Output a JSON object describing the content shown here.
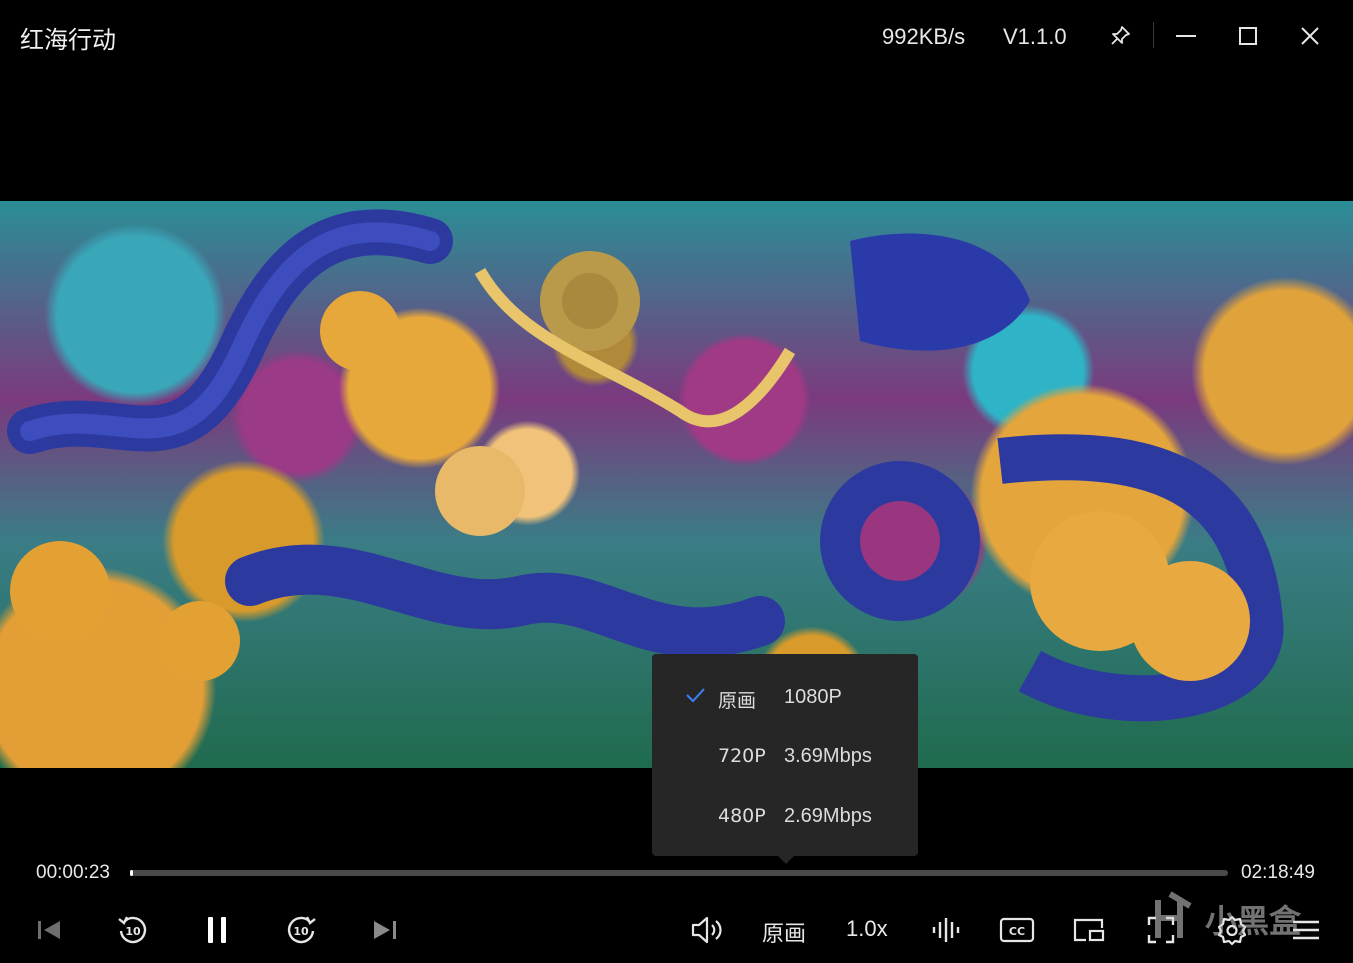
{
  "titlebar": {
    "title": "红海行动",
    "speed": "992KB/s",
    "version": "V1.1.0",
    "pin_icon": "pin-icon",
    "minimize_icon": "minimize-icon",
    "maximize_icon": "maximize-icon",
    "close_icon": "close-icon"
  },
  "quality_menu": {
    "items": [
      {
        "name": "原画",
        "rate": "1080P",
        "selected": true
      },
      {
        "name": "720P",
        "rate": "3.69Mbps",
        "selected": false
      },
      {
        "name": "480P",
        "rate": "2.69Mbps",
        "selected": false
      }
    ],
    "check_color": "#3b82f6"
  },
  "playback": {
    "current_time": "00:00:23",
    "total_time": "02:18:49",
    "progress": 0.003
  },
  "controls": {
    "quality_label": "原画",
    "speed_label": "1.0x",
    "buttons": [
      "previous-icon",
      "rewind-10-icon",
      "pause-icon",
      "forward-10-icon",
      "next-icon",
      "volume-icon",
      "audio-track-icon",
      "subtitle-cc-icon",
      "picture-in-picture-icon",
      "fullscreen-icon",
      "settings-icon",
      "playlist-icon"
    ]
  },
  "watermark": {
    "text": "小黑盒"
  }
}
